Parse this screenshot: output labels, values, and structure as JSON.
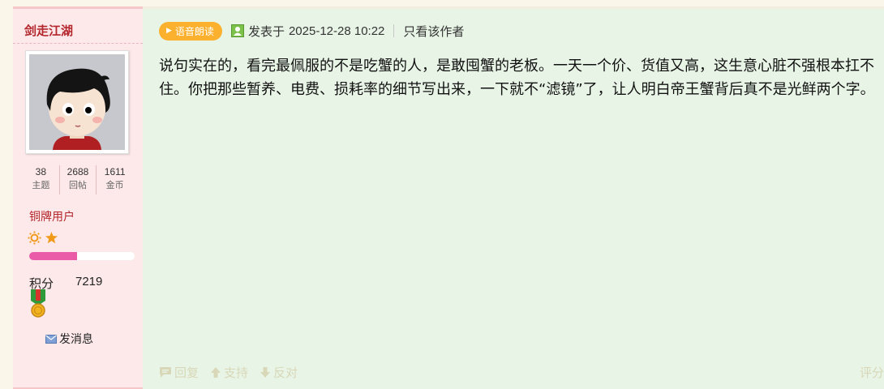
{
  "author": {
    "username": "剑走江湖",
    "stats": [
      {
        "value": "38",
        "label": "主题"
      },
      {
        "value": "2688",
        "label": "回帖"
      },
      {
        "value": "1611",
        "label": "金币"
      }
    ],
    "rank": "铜牌用户",
    "level_progress_percent": 45,
    "points_label": "积分",
    "points_value": "7219",
    "pm_label": "发消息"
  },
  "post": {
    "tts_label": "语音朗读",
    "posted_prefix": "发表于",
    "posted_time": "2025-12-28 10:22",
    "only_author_label": "只看该作者",
    "content": "说句实在的，看完最佩服的不是吃蟹的人，是敢囤蟹的老板。一天一个价、货值又高，这生意心脏不强根本扛不住。你把那些暂养、电费、损耗率的细节写出来，一下就不“滤镜”了，让人明白帝王蟹背后真不是光鲜两个字。",
    "actions": {
      "reply": "回复",
      "support": "支持",
      "oppose": "反对",
      "rate": "评分"
    }
  },
  "colors": {
    "sidebar_bg": "#fde9ea",
    "main_bg": "#e8f5e6",
    "username": "#b3262c",
    "tts_button": "#fcb12e",
    "progress_fill": "#ea5ca8"
  }
}
